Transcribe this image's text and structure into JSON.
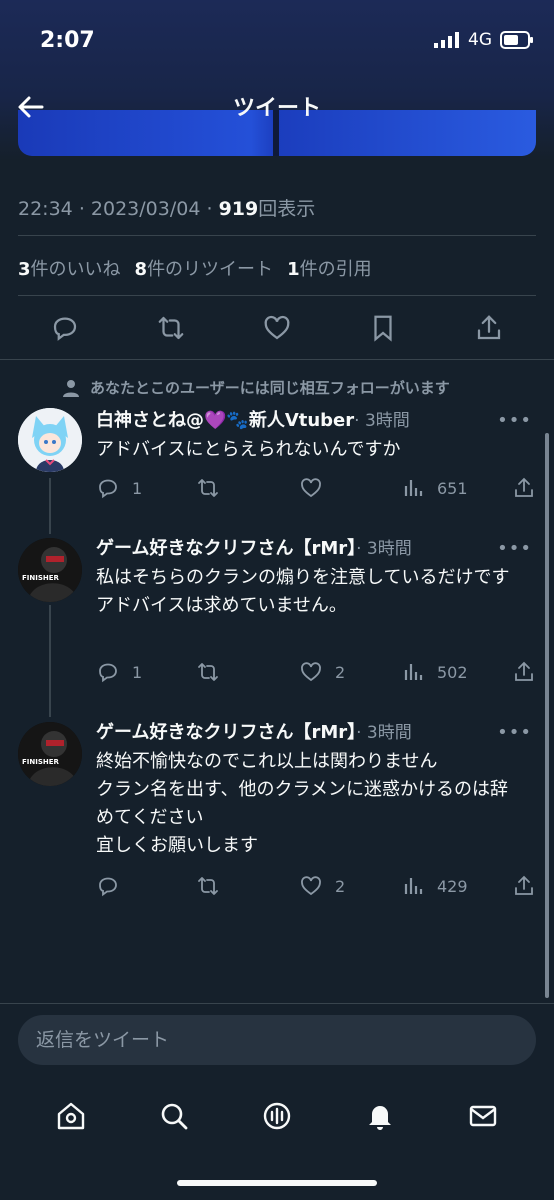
{
  "status_bar": {
    "time": "2:07",
    "network": "4G"
  },
  "header": {
    "title": "ツイート"
  },
  "tweet_meta": {
    "time": "22:34",
    "date": "2023/03/04",
    "views": "919",
    "views_suffix": "回表示",
    "sep": "·"
  },
  "stats": {
    "likes_count": "3",
    "likes_label": "件のいいね",
    "retweets_count": "8",
    "retweets_label": "件のリツイート",
    "quotes_count": "1",
    "quotes_label": "件の引用"
  },
  "follow_note": "あなたとこのユーザーには同じ相互フォローがいます",
  "replies": [
    {
      "name": "白神さとね@💜🐾新人Vtuber",
      "time": "· 3時間",
      "text": "アドバイスにとらえられないんですか",
      "comments": "1",
      "retweets": "",
      "likes": "",
      "views": "651"
    },
    {
      "name": "ゲーム好きなクリフさん【rMr】",
      "time": "· 3時間",
      "text": "私はそちらのクランの煽りを注意しているだけです\nアドバイスは求めていません。",
      "comments": "1",
      "retweets": "",
      "likes": "2",
      "views": "502"
    },
    {
      "name": "ゲーム好きなクリフさん【rMr】",
      "time": "· 3時間",
      "text": "終始不愉快なのでこれ以上は関わりません\nクラン名を出す、他のクラメンに迷惑かけるのは辞めてください\n宜しくお願いします",
      "comments": "",
      "retweets": "",
      "likes": "2",
      "views": "429"
    }
  ],
  "reply_input": {
    "placeholder": "返信をツイート"
  },
  "avatar_text": "FINISHER",
  "more": "•••",
  "colors": {
    "bg": "#15202b",
    "secondary": "#8b98a5",
    "accent_purple": "#9b59d6"
  }
}
